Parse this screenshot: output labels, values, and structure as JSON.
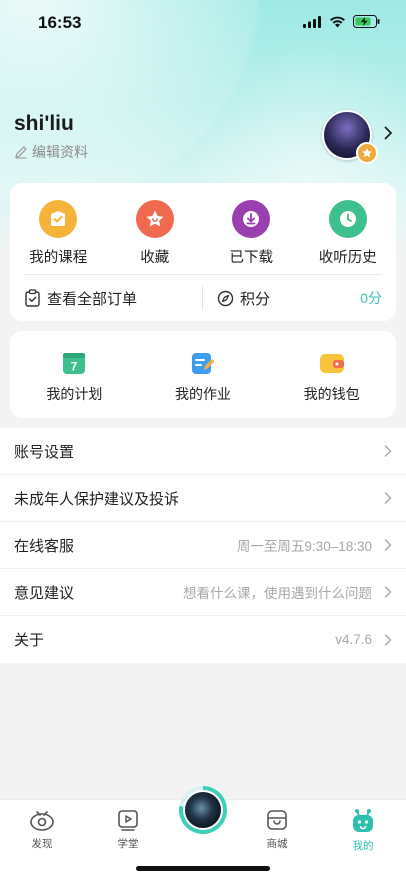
{
  "status_bar": {
    "time": "16:53"
  },
  "profile": {
    "username": "shi'liu",
    "edit_label": "编辑资料"
  },
  "quick_actions": [
    {
      "label": "我的课程",
      "icon": "course-icon",
      "color": "#f6b33a"
    },
    {
      "label": "收藏",
      "icon": "star-icon",
      "color": "#f06a4f"
    },
    {
      "label": "已下载",
      "icon": "download-icon",
      "color": "#9a3fb0"
    },
    {
      "label": "收听历史",
      "icon": "clock-icon",
      "color": "#3ebf8e"
    }
  ],
  "orders": {
    "label": "查看全部订单"
  },
  "points": {
    "label": "积分",
    "value": "0分"
  },
  "tools": [
    {
      "label": "我的计划",
      "icon": "calendar-icon"
    },
    {
      "label": "我的作业",
      "icon": "homework-icon"
    },
    {
      "label": "我的钱包",
      "icon": "wallet-icon"
    }
  ],
  "menu": [
    {
      "label": "账号设置",
      "value": ""
    },
    {
      "label": "未成年人保护建议及投诉",
      "value": ""
    },
    {
      "label": "在线客服",
      "value": "周一至周五9:30–18:30"
    },
    {
      "label": "意见建议",
      "value": "想看什么课，使用遇到什么问题"
    },
    {
      "label": "关于",
      "value": "v4.7.6"
    }
  ],
  "tabbar": {
    "discover": "发现",
    "school": "学堂",
    "mall": "商城",
    "me": "我的"
  },
  "colors": {
    "accent": "#2fbfae",
    "background": "#f3f3f3"
  }
}
